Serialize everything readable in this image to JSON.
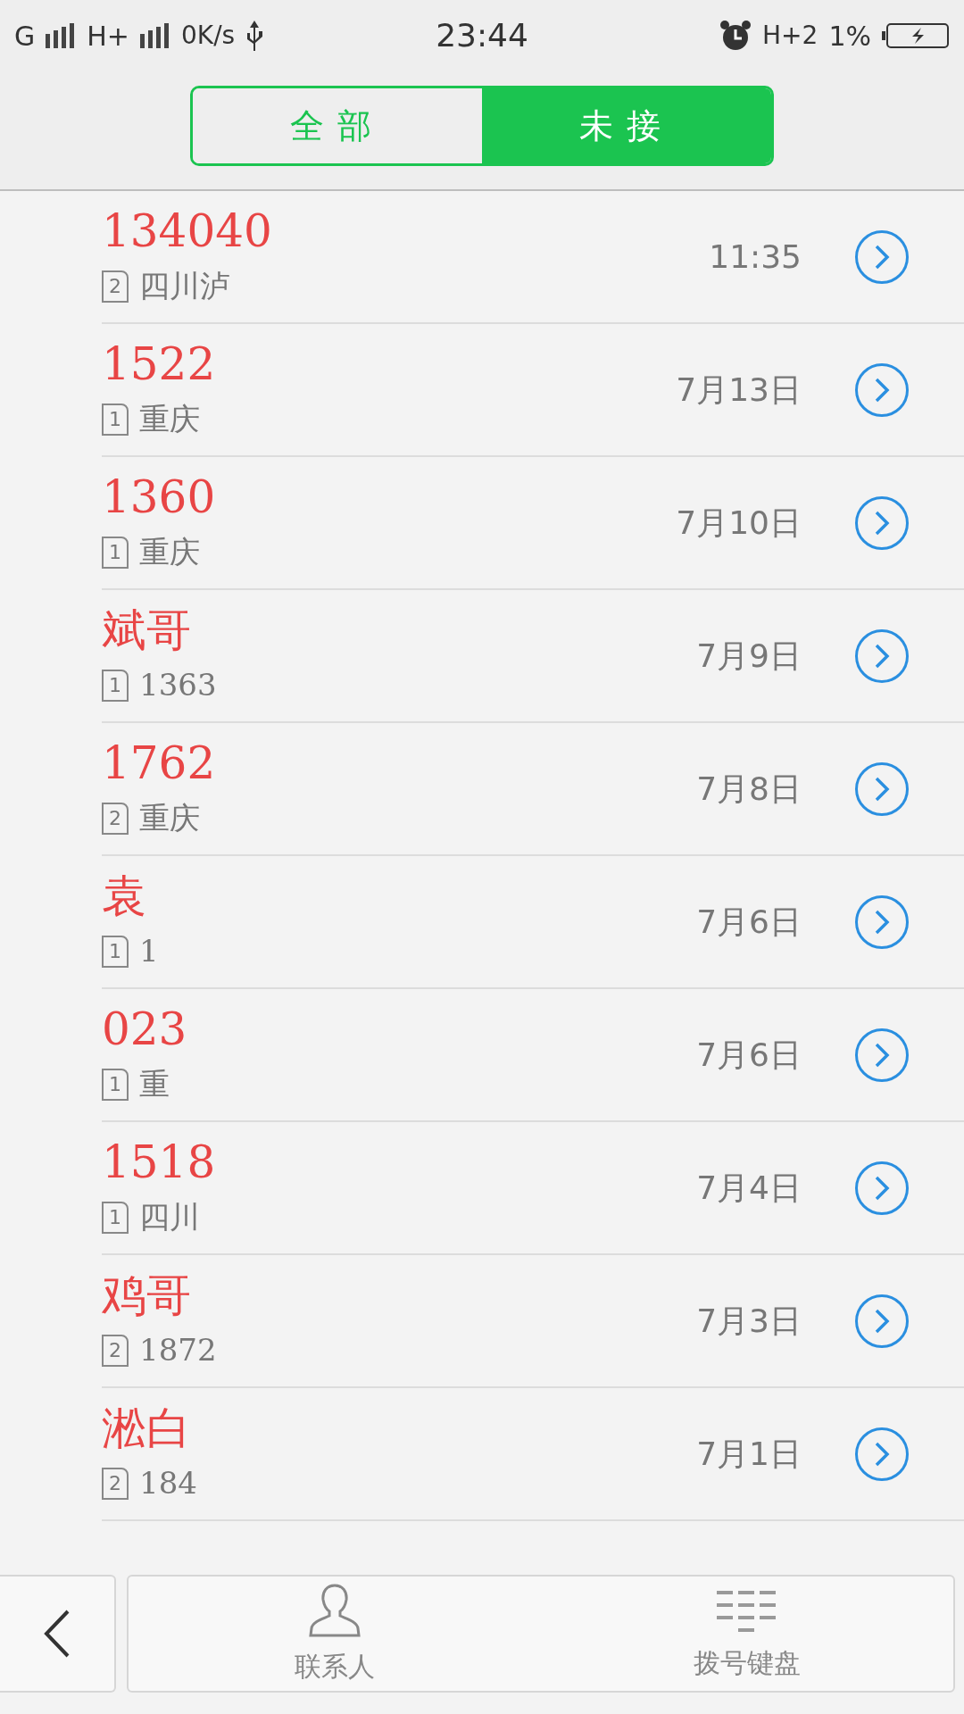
{
  "status_bar": {
    "left": [
      "G",
      "H+"
    ],
    "speed": "0K/s",
    "time": "23:44",
    "network": "H+2",
    "battery": "1%"
  },
  "tabs": [
    {
      "label": "全部",
      "selected": false
    },
    {
      "label": "未接",
      "selected": true
    }
  ],
  "calls": [
    {
      "name": "134040",
      "sim": "2",
      "detail": "四川泸",
      "date": "11:35"
    },
    {
      "name": "1522",
      "sim": "1",
      "detail": "重庆",
      "date": "7月13日"
    },
    {
      "name": "1360",
      "sim": "1",
      "detail": "重庆",
      "date": "7月10日"
    },
    {
      "name": "斌哥",
      "sim": "1",
      "detail": "1363",
      "date": "7月9日"
    },
    {
      "name": "1762",
      "sim": "2",
      "detail": "重庆",
      "date": "7月8日"
    },
    {
      "name": "袁",
      "sim": "1",
      "detail": "1",
      "date": "7月6日"
    },
    {
      "name": "023",
      "sim": "1",
      "detail": "重",
      "date": "7月6日"
    },
    {
      "name": "1518",
      "sim": "1",
      "detail": "四川",
      "date": "7月4日"
    },
    {
      "name": "鸡哥",
      "sim": "2",
      "detail": "1872",
      "date": "7月3日"
    },
    {
      "name": "淞白",
      "sim": "2",
      "detail": "184",
      "date": "7月1日"
    }
  ],
  "bottom_bar": {
    "items": [
      {
        "label": "联系人",
        "kind": "contacts"
      },
      {
        "label": "拨号键盘",
        "kind": "dialpad"
      }
    ]
  }
}
